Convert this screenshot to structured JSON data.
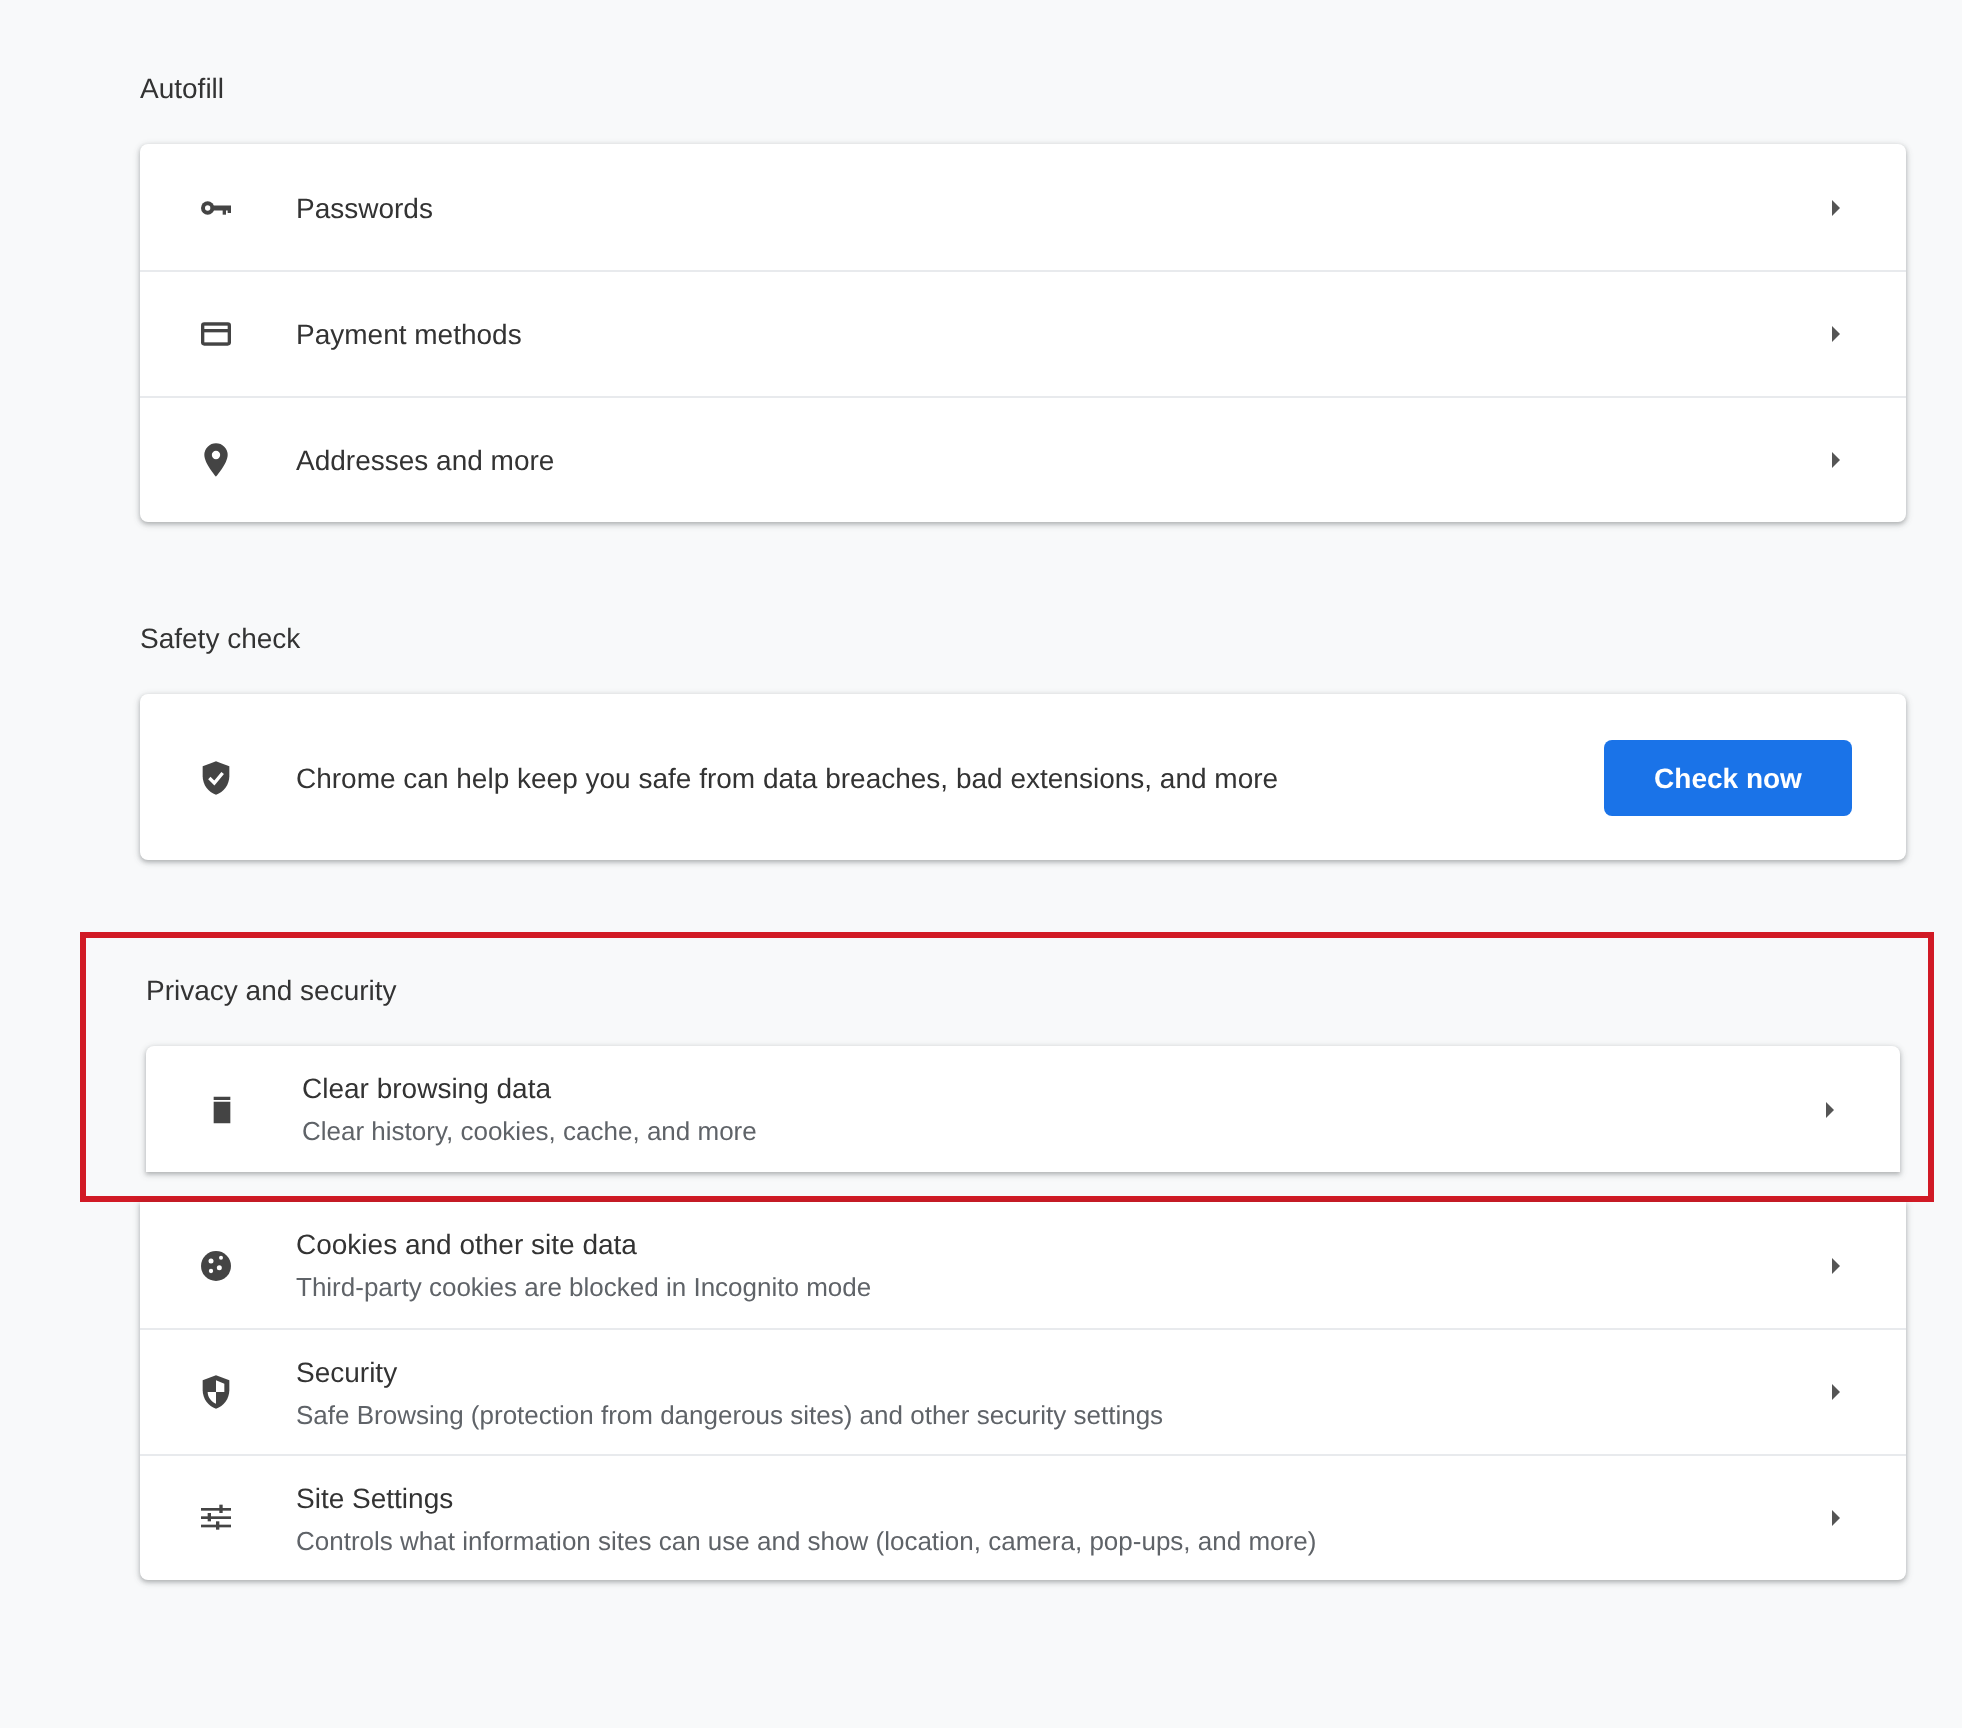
{
  "sections": [
    {
      "title": "Autofill",
      "items": [
        {
          "kind": "link",
          "label": "Passwords",
          "highlighted": false
        },
        {
          "kind": "link",
          "label": "Payment methods",
          "highlighted": false
        },
        {
          "kind": "link",
          "label": "Addresses and more",
          "highlighted": false
        }
      ]
    },
    {
      "title": "Safety check",
      "items": [
        {
          "kind": "action",
          "label": "Chrome can help keep you safe from data breaches, bad extensions, and more",
          "button": "Check now",
          "highlighted": false
        }
      ]
    },
    {
      "title": "Privacy and security",
      "items": [
        {
          "kind": "link",
          "label": "Clear browsing data",
          "sublabel": "Clear history, cookies, cache, and more",
          "highlighted": true
        },
        {
          "kind": "link",
          "label": "Cookies and other site data",
          "sublabel": "Third-party cookies are blocked in Incognito mode",
          "highlighted": false
        },
        {
          "kind": "link",
          "label": "Security",
          "sublabel": "Safe Browsing (protection from dangerous sites) and other security settings",
          "highlighted": false
        },
        {
          "kind": "link",
          "label": "Site Settings",
          "sublabel": "Controls what information sites can use and show (location, camera, pop-ups, and more)",
          "highlighted": false
        }
      ]
    }
  ]
}
